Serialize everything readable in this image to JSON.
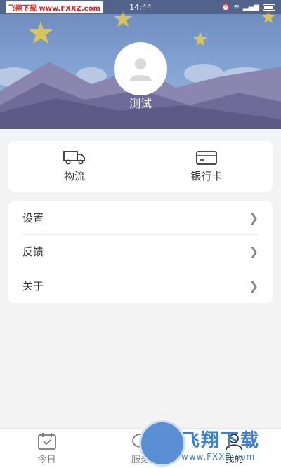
{
  "status_bar": {
    "watermark": "飞翔下载 www.FXXZ.com",
    "time": "14:44"
  },
  "profile": {
    "username": "测试"
  },
  "quick_actions": [
    {
      "label": "物流",
      "icon": "truck-icon"
    },
    {
      "label": "银行卡",
      "icon": "bank-card-icon"
    }
  ],
  "menu": [
    {
      "label": "设置"
    },
    {
      "label": "反馈"
    },
    {
      "label": "关于"
    }
  ],
  "tabs": [
    {
      "label": "今日",
      "icon": "calendar-icon",
      "active": false
    },
    {
      "label": "服务",
      "icon": "chat-icon",
      "active": false
    },
    {
      "label": "我的",
      "icon": "user-icon",
      "active": true
    }
  ],
  "watermark": {
    "title": "飞翔下载",
    "url": "www.FXXZ.com"
  },
  "colors": {
    "header_sky": "#7fa0d0",
    "background": "#f3f3f3",
    "card": "#ffffff",
    "watermark_blue": "#3b7fd4"
  }
}
